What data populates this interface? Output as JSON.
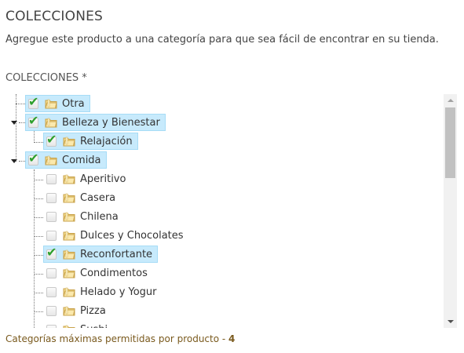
{
  "section": {
    "title": "COLECCIONES",
    "description": "Agregue este producto a una categoría para que sea fácil de encontrar en su tienda.",
    "field_label": "COLECCIONES *"
  },
  "tree": {
    "nodes": [
      {
        "label": "Otra",
        "checked": true,
        "selected": true,
        "level": 0,
        "expanded": null
      },
      {
        "label": "Belleza y Bienestar",
        "checked": true,
        "selected": true,
        "level": 0,
        "expanded": true
      },
      {
        "label": "Relajación",
        "checked": true,
        "selected": true,
        "level": 1,
        "expanded": null
      },
      {
        "label": "Comida",
        "checked": true,
        "selected": true,
        "level": 0,
        "expanded": true
      },
      {
        "label": "Aperitivo",
        "checked": false,
        "selected": false,
        "level": 1,
        "expanded": null
      },
      {
        "label": "Casera",
        "checked": false,
        "selected": false,
        "level": 1,
        "expanded": null
      },
      {
        "label": "Chilena",
        "checked": false,
        "selected": false,
        "level": 1,
        "expanded": null
      },
      {
        "label": "Dulces y Chocolates",
        "checked": false,
        "selected": false,
        "level": 1,
        "expanded": null
      },
      {
        "label": "Reconfortante",
        "checked": true,
        "selected": true,
        "level": 1,
        "expanded": null
      },
      {
        "label": "Condimentos",
        "checked": false,
        "selected": false,
        "level": 1,
        "expanded": null
      },
      {
        "label": "Helado y Yogur",
        "checked": false,
        "selected": false,
        "level": 1,
        "expanded": null
      },
      {
        "label": "Pizza",
        "checked": false,
        "selected": false,
        "level": 1,
        "expanded": null
      },
      {
        "label": "Sushi",
        "checked": false,
        "selected": false,
        "level": 1,
        "expanded": null
      }
    ]
  },
  "footer": {
    "text": "Categorías máximas permitidas por producto - ",
    "max": "4"
  },
  "icons": {
    "folder": "folder-icon",
    "check": "checkmark-icon",
    "expand": "expand-arrow-icon"
  },
  "colors": {
    "selected_bg": "#c7eafc",
    "check_green": "#2ea02e",
    "footer_text": "#7a5a1e"
  }
}
